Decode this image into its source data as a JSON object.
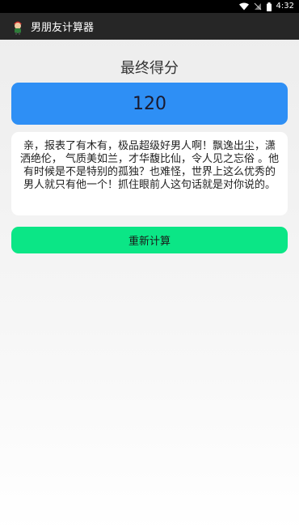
{
  "status_bar": {
    "time": "4:32",
    "icons": [
      "wifi-icon",
      "signal-off-icon",
      "battery-icon"
    ]
  },
  "app_bar": {
    "title": "男朋友计算器",
    "icon": "app-character-icon"
  },
  "main": {
    "heading": "最终得分",
    "score": "120",
    "message": "亲，报表了有木有，极品超级好男人啊！飘逸出尘，潇洒绝伦， 气质美如兰，才华馥比仙，令人见之忘俗 。他有时候是不是特别的孤独？也难怪，世界上这么优秀的男人就只有他一个！抓住眼前人这句话就是对你说的。",
    "recalc_label": "重新计算"
  },
  "colors": {
    "score_bg": "#2e8ff5",
    "button_bg": "#0be686",
    "app_bar_bg": "#262626",
    "status_bar_bg": "#000000"
  }
}
